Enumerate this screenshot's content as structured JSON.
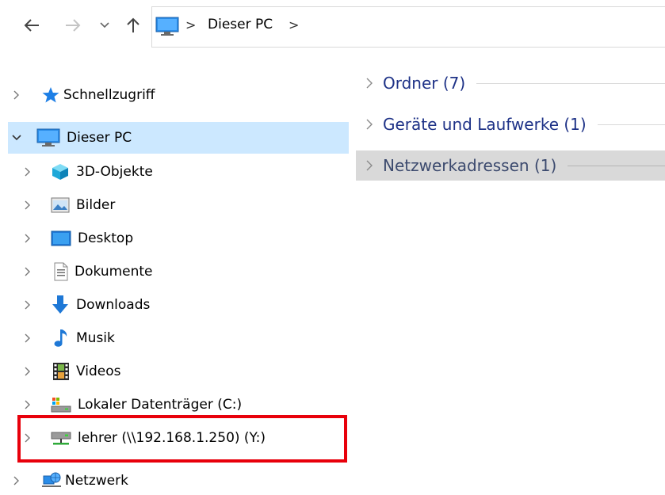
{
  "toolbar": {
    "back_icon": "arrow-left-icon",
    "forward_icon": "arrow-right-icon",
    "recent_icon": "chevron-down-icon",
    "up_icon": "arrow-up-icon"
  },
  "address": {
    "icon": "computer-icon",
    "separator": ">",
    "path": "Dieser PC",
    "trailing_separator": ">"
  },
  "sidebar": {
    "items": [
      {
        "label": "Schnellzugriff",
        "icon": "star-icon",
        "expanded": false
      },
      {
        "label": "Dieser PC",
        "icon": "computer-icon",
        "expanded": true,
        "selected": true
      },
      {
        "label": "3D-Objekte",
        "icon": "cube-icon",
        "expanded": false
      },
      {
        "label": "Bilder",
        "icon": "pictures-icon",
        "expanded": false
      },
      {
        "label": "Desktop",
        "icon": "desktop-icon",
        "expanded": false
      },
      {
        "label": "Dokumente",
        "icon": "document-icon",
        "expanded": false
      },
      {
        "label": "Downloads",
        "icon": "download-icon",
        "expanded": false
      },
      {
        "label": "Musik",
        "icon": "music-icon",
        "expanded": false
      },
      {
        "label": "Videos",
        "icon": "video-icon",
        "expanded": false
      },
      {
        "label": "Lokaler Datenträger (C:)",
        "icon": "drive-icon",
        "expanded": false
      },
      {
        "label": "lehrer (\\\\192.168.1.250) (Y:)",
        "icon": "network-drive-icon",
        "expanded": false,
        "annotated": true
      },
      {
        "label": "Netzwerk",
        "icon": "network-icon",
        "expanded": false
      }
    ]
  },
  "main": {
    "groups": [
      {
        "label": "Ordner (7)",
        "expanded": false
      },
      {
        "label": "Geräte und Laufwerke (1)",
        "expanded": false
      },
      {
        "label": "Netzwerkadressen (1)",
        "expanded": false,
        "highlighted": true
      }
    ]
  },
  "colors": {
    "selection": "#cce8ff",
    "group_text": "#1e3287",
    "annotation": "#e8000b"
  }
}
